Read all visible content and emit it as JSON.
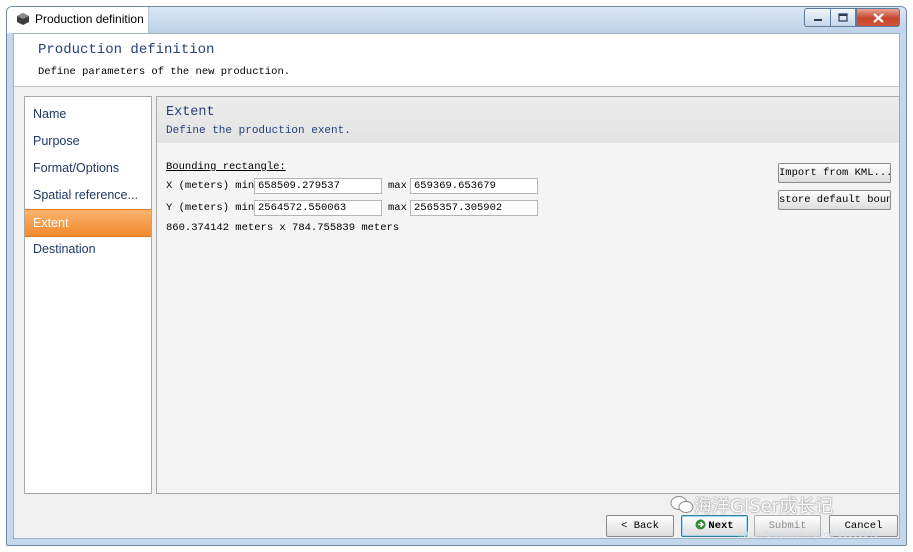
{
  "window": {
    "title": "Production definition"
  },
  "header": {
    "title": "Production definition",
    "subtitle": "Define parameters of the new production."
  },
  "sidebar": {
    "items": [
      {
        "label": "Name",
        "active": false
      },
      {
        "label": "Purpose",
        "active": false
      },
      {
        "label": "Format/Options",
        "active": false
      },
      {
        "label": "Spatial reference...",
        "active": false
      },
      {
        "label": "Extent",
        "active": true
      },
      {
        "label": "Destination",
        "active": false
      }
    ]
  },
  "extent": {
    "title": "Extent",
    "subtitle": "Define the production exent.",
    "bounding_label": "Bounding rectangle:",
    "x_label": "X (meters) min",
    "x_min": "658509.279537",
    "x_max_label": "max",
    "x_max": "659369.653679",
    "y_label": "Y (meters) min",
    "y_min": "2564572.550063",
    "y_max_label": "max",
    "y_max": "2565357.305902",
    "size_text": "860.374142 meters x 784.755839 meters",
    "import_button": "Import from KML...",
    "store_button": "store default boun"
  },
  "footer": {
    "back": "< Back",
    "next": "Next",
    "submit": "Submit",
    "cancel": "Cancel"
  },
  "watermark": {
    "text": "海洋GISer成长记",
    "url": "https://blog.csdn.net/qq_35099640"
  },
  "colors": {
    "accent": "#f2892e",
    "title_blue": "#27407a",
    "close_red": "#c7422a"
  }
}
